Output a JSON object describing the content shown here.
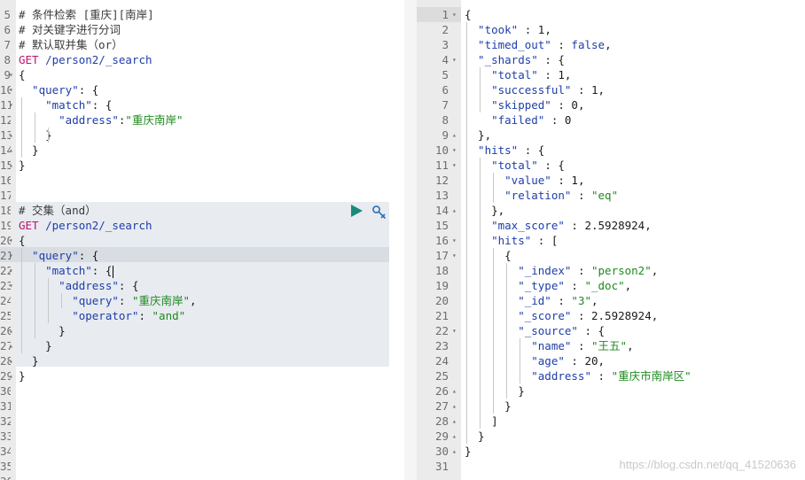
{
  "left_editor": {
    "lines": [
      {
        "num": "5",
        "fold": "",
        "tokens": [
          {
            "t": "# 条件检索 [重庆][南岸]",
            "c": "c"
          }
        ]
      },
      {
        "num": "6",
        "fold": "",
        "tokens": [
          {
            "t": "# 对关键字进行分词",
            "c": "c"
          }
        ]
      },
      {
        "num": "7",
        "fold": "",
        "tokens": [
          {
            "t": "# 默认取并集（or）",
            "c": "c"
          }
        ]
      },
      {
        "num": "8",
        "fold": "",
        "tokens": [
          {
            "t": "GET",
            "c": "m"
          },
          {
            "t": " /person2/_search",
            "c": "k"
          }
        ]
      },
      {
        "num": "9",
        "fold": "▾",
        "tokens": [
          {
            "t": "{",
            "c": "p"
          }
        ]
      },
      {
        "num": "10",
        "fold": "▾",
        "tokens": [
          {
            "t": "  \"query\"",
            "c": "k"
          },
          {
            "t": ": {",
            "c": "p"
          }
        ]
      },
      {
        "num": "11",
        "fold": "▾",
        "tokens": [
          {
            "t": "    \"match\"",
            "c": "k"
          },
          {
            "t": ": {",
            "c": "p"
          }
        ]
      },
      {
        "num": "12",
        "fold": "",
        "tokens": [
          {
            "t": "      \"address\"",
            "c": "k"
          },
          {
            "t": ":",
            "c": "p"
          },
          {
            "t": "\"重庆南岸\"",
            "c": "s"
          }
        ]
      },
      {
        "num": "13",
        "fold": "▴",
        "tokens": [
          {
            "t": "    }",
            "c": "p"
          }
        ]
      },
      {
        "num": "14",
        "fold": "▴",
        "tokens": [
          {
            "t": "  }",
            "c": "p"
          }
        ]
      },
      {
        "num": "15",
        "fold": "▴",
        "tokens": [
          {
            "t": "}",
            "c": "p"
          }
        ]
      },
      {
        "num": "16",
        "fold": "",
        "tokens": []
      },
      {
        "num": "17",
        "fold": "",
        "tokens": []
      },
      {
        "num": "18",
        "fold": "",
        "tokens": [
          {
            "t": "# 交集（and）",
            "c": "c"
          }
        ]
      },
      {
        "num": "19",
        "fold": "",
        "tokens": [
          {
            "t": "GET",
            "c": "m"
          },
          {
            "t": " /person2/_search",
            "c": "k"
          }
        ]
      },
      {
        "num": "20",
        "fold": "▾",
        "tokens": [
          {
            "t": "{",
            "c": "p"
          }
        ]
      },
      {
        "num": "21",
        "fold": "▾",
        "tokens": [
          {
            "t": "  \"query\"",
            "c": "k"
          },
          {
            "t": ": {",
            "c": "p"
          }
        ]
      },
      {
        "num": "22",
        "fold": "▾",
        "tokens": [
          {
            "t": "    \"match\"",
            "c": "k"
          },
          {
            "t": ": {",
            "c": "p"
          }
        ],
        "cursor": true
      },
      {
        "num": "23",
        "fold": "▾",
        "tokens": [
          {
            "t": "      \"address\"",
            "c": "k"
          },
          {
            "t": ": {",
            "c": "p"
          }
        ]
      },
      {
        "num": "24",
        "fold": "",
        "tokens": [
          {
            "t": "        \"query\"",
            "c": "k"
          },
          {
            "t": ": ",
            "c": "p"
          },
          {
            "t": "\"重庆南岸\"",
            "c": "s"
          },
          {
            "t": ",",
            "c": "p"
          }
        ]
      },
      {
        "num": "25",
        "fold": "",
        "tokens": [
          {
            "t": "        \"operator\"",
            "c": "k"
          },
          {
            "t": ": ",
            "c": "p"
          },
          {
            "t": "\"and\"",
            "c": "s"
          }
        ]
      },
      {
        "num": "26",
        "fold": "▴",
        "tokens": [
          {
            "t": "      }",
            "c": "p"
          }
        ]
      },
      {
        "num": "27",
        "fold": "▴",
        "tokens": [
          {
            "t": "    }",
            "c": "p"
          }
        ]
      },
      {
        "num": "28",
        "fold": "▴",
        "tokens": [
          {
            "t": "  }",
            "c": "p"
          }
        ]
      },
      {
        "num": "29",
        "fold": "▴",
        "tokens": [
          {
            "t": "}",
            "c": "p"
          }
        ]
      },
      {
        "num": "30",
        "fold": "",
        "tokens": []
      },
      {
        "num": "31",
        "fold": "",
        "tokens": []
      },
      {
        "num": "32",
        "fold": "",
        "tokens": []
      },
      {
        "num": "33",
        "fold": "",
        "tokens": []
      },
      {
        "num": "34",
        "fold": "",
        "tokens": []
      },
      {
        "num": "35",
        "fold": "",
        "tokens": []
      },
      {
        "num": "36",
        "fold": "",
        "tokens": []
      }
    ]
  },
  "right_editor": {
    "lines": [
      {
        "num": "1",
        "fold": "▾",
        "tokens": [
          {
            "t": "{",
            "c": "p"
          }
        ]
      },
      {
        "num": "2",
        "fold": "",
        "tokens": [
          {
            "t": "  \"took\"",
            "c": "k"
          },
          {
            "t": " : ",
            "c": "p"
          },
          {
            "t": "1",
            "c": "n"
          },
          {
            "t": ",",
            "c": "p"
          }
        ]
      },
      {
        "num": "3",
        "fold": "",
        "tokens": [
          {
            "t": "  \"timed_out\"",
            "c": "k"
          },
          {
            "t": " : ",
            "c": "p"
          },
          {
            "t": "false",
            "c": "bool"
          },
          {
            "t": ",",
            "c": "p"
          }
        ]
      },
      {
        "num": "4",
        "fold": "▾",
        "tokens": [
          {
            "t": "  \"_shards\"",
            "c": "k"
          },
          {
            "t": " : {",
            "c": "p"
          }
        ]
      },
      {
        "num": "5",
        "fold": "",
        "tokens": [
          {
            "t": "    \"total\"",
            "c": "k"
          },
          {
            "t": " : ",
            "c": "p"
          },
          {
            "t": "1",
            "c": "n"
          },
          {
            "t": ",",
            "c": "p"
          }
        ]
      },
      {
        "num": "6",
        "fold": "",
        "tokens": [
          {
            "t": "    \"successful\"",
            "c": "k"
          },
          {
            "t": " : ",
            "c": "p"
          },
          {
            "t": "1",
            "c": "n"
          },
          {
            "t": ",",
            "c": "p"
          }
        ]
      },
      {
        "num": "7",
        "fold": "",
        "tokens": [
          {
            "t": "    \"skipped\"",
            "c": "k"
          },
          {
            "t": " : ",
            "c": "p"
          },
          {
            "t": "0",
            "c": "n"
          },
          {
            "t": ",",
            "c": "p"
          }
        ]
      },
      {
        "num": "8",
        "fold": "",
        "tokens": [
          {
            "t": "    \"failed\"",
            "c": "k"
          },
          {
            "t": " : ",
            "c": "p"
          },
          {
            "t": "0",
            "c": "n"
          }
        ]
      },
      {
        "num": "9",
        "fold": "▴",
        "tokens": [
          {
            "t": "  },",
            "c": "p"
          }
        ]
      },
      {
        "num": "10",
        "fold": "▾",
        "tokens": [
          {
            "t": "  \"hits\"",
            "c": "k"
          },
          {
            "t": " : {",
            "c": "p"
          }
        ]
      },
      {
        "num": "11",
        "fold": "▾",
        "tokens": [
          {
            "t": "    \"total\"",
            "c": "k"
          },
          {
            "t": " : {",
            "c": "p"
          }
        ]
      },
      {
        "num": "12",
        "fold": "",
        "tokens": [
          {
            "t": "      \"value\"",
            "c": "k"
          },
          {
            "t": " : ",
            "c": "p"
          },
          {
            "t": "1",
            "c": "n"
          },
          {
            "t": ",",
            "c": "p"
          }
        ]
      },
      {
        "num": "13",
        "fold": "",
        "tokens": [
          {
            "t": "      \"relation\"",
            "c": "k"
          },
          {
            "t": " : ",
            "c": "p"
          },
          {
            "t": "\"eq\"",
            "c": "s"
          }
        ]
      },
      {
        "num": "14",
        "fold": "▴",
        "tokens": [
          {
            "t": "    },",
            "c": "p"
          }
        ]
      },
      {
        "num": "15",
        "fold": "",
        "tokens": [
          {
            "t": "    \"max_score\"",
            "c": "k"
          },
          {
            "t": " : ",
            "c": "p"
          },
          {
            "t": "2.5928924",
            "c": "n"
          },
          {
            "t": ",",
            "c": "p"
          }
        ]
      },
      {
        "num": "16",
        "fold": "▾",
        "tokens": [
          {
            "t": "    \"hits\"",
            "c": "k"
          },
          {
            "t": " : [",
            "c": "p"
          }
        ]
      },
      {
        "num": "17",
        "fold": "▾",
        "tokens": [
          {
            "t": "      {",
            "c": "p"
          }
        ]
      },
      {
        "num": "18",
        "fold": "",
        "tokens": [
          {
            "t": "        \"_index\"",
            "c": "k"
          },
          {
            "t": " : ",
            "c": "p"
          },
          {
            "t": "\"person2\"",
            "c": "s"
          },
          {
            "t": ",",
            "c": "p"
          }
        ]
      },
      {
        "num": "19",
        "fold": "",
        "tokens": [
          {
            "t": "        \"_type\"",
            "c": "k"
          },
          {
            "t": " : ",
            "c": "p"
          },
          {
            "t": "\"_doc\"",
            "c": "s"
          },
          {
            "t": ",",
            "c": "p"
          }
        ]
      },
      {
        "num": "20",
        "fold": "",
        "tokens": [
          {
            "t": "        \"_id\"",
            "c": "k"
          },
          {
            "t": " : ",
            "c": "p"
          },
          {
            "t": "\"3\"",
            "c": "s"
          },
          {
            "t": ",",
            "c": "p"
          }
        ]
      },
      {
        "num": "21",
        "fold": "",
        "tokens": [
          {
            "t": "        \"_score\"",
            "c": "k"
          },
          {
            "t": " : ",
            "c": "p"
          },
          {
            "t": "2.5928924",
            "c": "n"
          },
          {
            "t": ",",
            "c": "p"
          }
        ]
      },
      {
        "num": "22",
        "fold": "▾",
        "tokens": [
          {
            "t": "        \"_source\"",
            "c": "k"
          },
          {
            "t": " : {",
            "c": "p"
          }
        ]
      },
      {
        "num": "23",
        "fold": "",
        "tokens": [
          {
            "t": "          \"name\"",
            "c": "k"
          },
          {
            "t": " : ",
            "c": "p"
          },
          {
            "t": "\"王五\"",
            "c": "s"
          },
          {
            "t": ",",
            "c": "p"
          }
        ]
      },
      {
        "num": "24",
        "fold": "",
        "tokens": [
          {
            "t": "          \"age\"",
            "c": "k"
          },
          {
            "t": " : ",
            "c": "p"
          },
          {
            "t": "20",
            "c": "n"
          },
          {
            "t": ",",
            "c": "p"
          }
        ]
      },
      {
        "num": "25",
        "fold": "",
        "tokens": [
          {
            "t": "          \"address\"",
            "c": "k"
          },
          {
            "t": " : ",
            "c": "p"
          },
          {
            "t": "\"重庆市南岸区\"",
            "c": "s"
          }
        ]
      },
      {
        "num": "26",
        "fold": "▴",
        "tokens": [
          {
            "t": "        }",
            "c": "p"
          }
        ]
      },
      {
        "num": "27",
        "fold": "▴",
        "tokens": [
          {
            "t": "      }",
            "c": "p"
          }
        ]
      },
      {
        "num": "28",
        "fold": "▴",
        "tokens": [
          {
            "t": "    ]",
            "c": "p"
          }
        ]
      },
      {
        "num": "29",
        "fold": "▴",
        "tokens": [
          {
            "t": "  }",
            "c": "p"
          }
        ]
      },
      {
        "num": "30",
        "fold": "▴",
        "tokens": [
          {
            "t": "}",
            "c": "p"
          }
        ]
      },
      {
        "num": "31",
        "fold": "",
        "tokens": []
      }
    ]
  },
  "toolbar": {
    "run_icon": "play-icon",
    "settings_icon": "wrench-icon"
  },
  "watermark": "https://blog.csdn.net/qq_41520636",
  "colors": {
    "keyword": "#1e3ea8",
    "string": "#1f8a1f",
    "method": "#c0136e",
    "play": "#1b8a7a",
    "wrench": "#2b6fb8"
  }
}
